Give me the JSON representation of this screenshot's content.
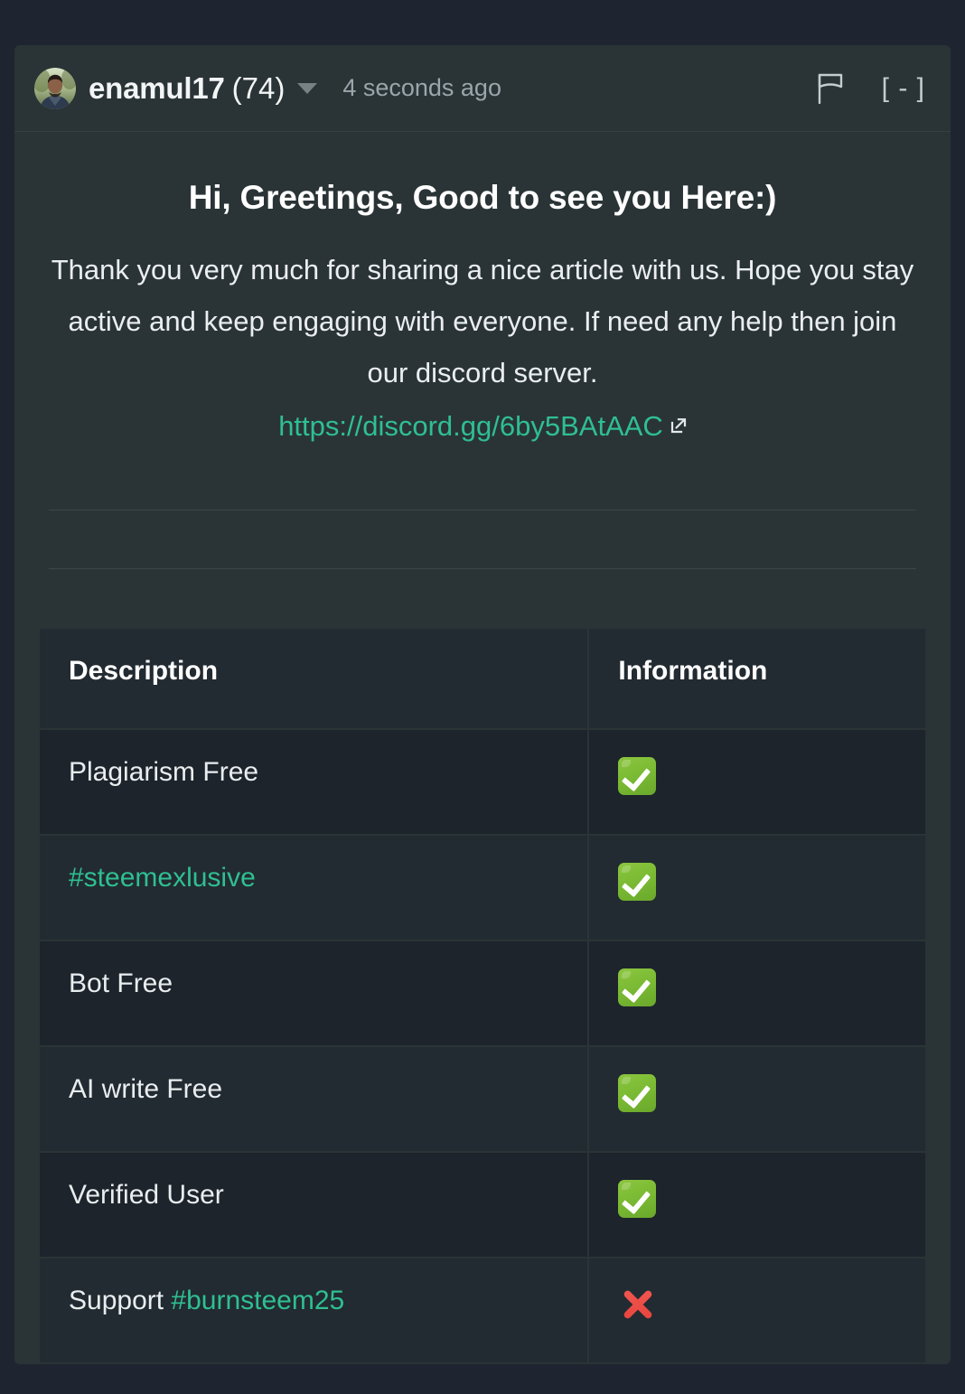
{
  "comment": {
    "author": {
      "username": "enamul17",
      "reputation": "(74)",
      "avatar_icon": "user-photo-avatar",
      "dropdown_icon": "chevron-down-icon"
    },
    "timestamp": "4 seconds ago",
    "actions": {
      "flag_icon": "flag-icon",
      "collapse_label": "[ - ]"
    },
    "title": "Hi, Greetings, Good to see you Here:)",
    "paragraph": "Thank you very much for sharing a nice article with us. Hope you stay active and keep engaging with everyone. If need any help then join our discord server.",
    "discord_link": {
      "text": "https://discord.gg/6by5BAtAAC",
      "external_icon": "external-link-icon"
    }
  },
  "table": {
    "headers": [
      "Description",
      "Information"
    ],
    "rows": [
      {
        "description_plain": "Plagiarism Free",
        "description_tag": "",
        "mark": "check",
        "mark_icon": "white-check-mark-icon"
      },
      {
        "description_plain": "",
        "description_tag": "#steemexlusive",
        "mark": "check",
        "mark_icon": "white-check-mark-icon"
      },
      {
        "description_plain": "Bot Free",
        "description_tag": "",
        "mark": "check",
        "mark_icon": "white-check-mark-icon"
      },
      {
        "description_plain": "AI write Free",
        "description_tag": "",
        "mark": "check",
        "mark_icon": "white-check-mark-icon"
      },
      {
        "description_plain": "Verified User",
        "description_tag": "",
        "mark": "check",
        "mark_icon": "white-check-mark-icon"
      },
      {
        "description_plain": "Support ",
        "description_tag": "#burnsteem25",
        "mark": "cross",
        "mark_icon": "cross-mark-icon"
      }
    ]
  },
  "colors": {
    "page_background": "#1e2530",
    "card_background": "#2a3436",
    "accent_link": "#2fbf92",
    "row_dark": "#1d242c",
    "row_light": "#222b31",
    "check_green": "#78b832",
    "cross_red": "#e8463f",
    "text_primary": "#ffffff",
    "text_muted": "#9aa6ab"
  }
}
